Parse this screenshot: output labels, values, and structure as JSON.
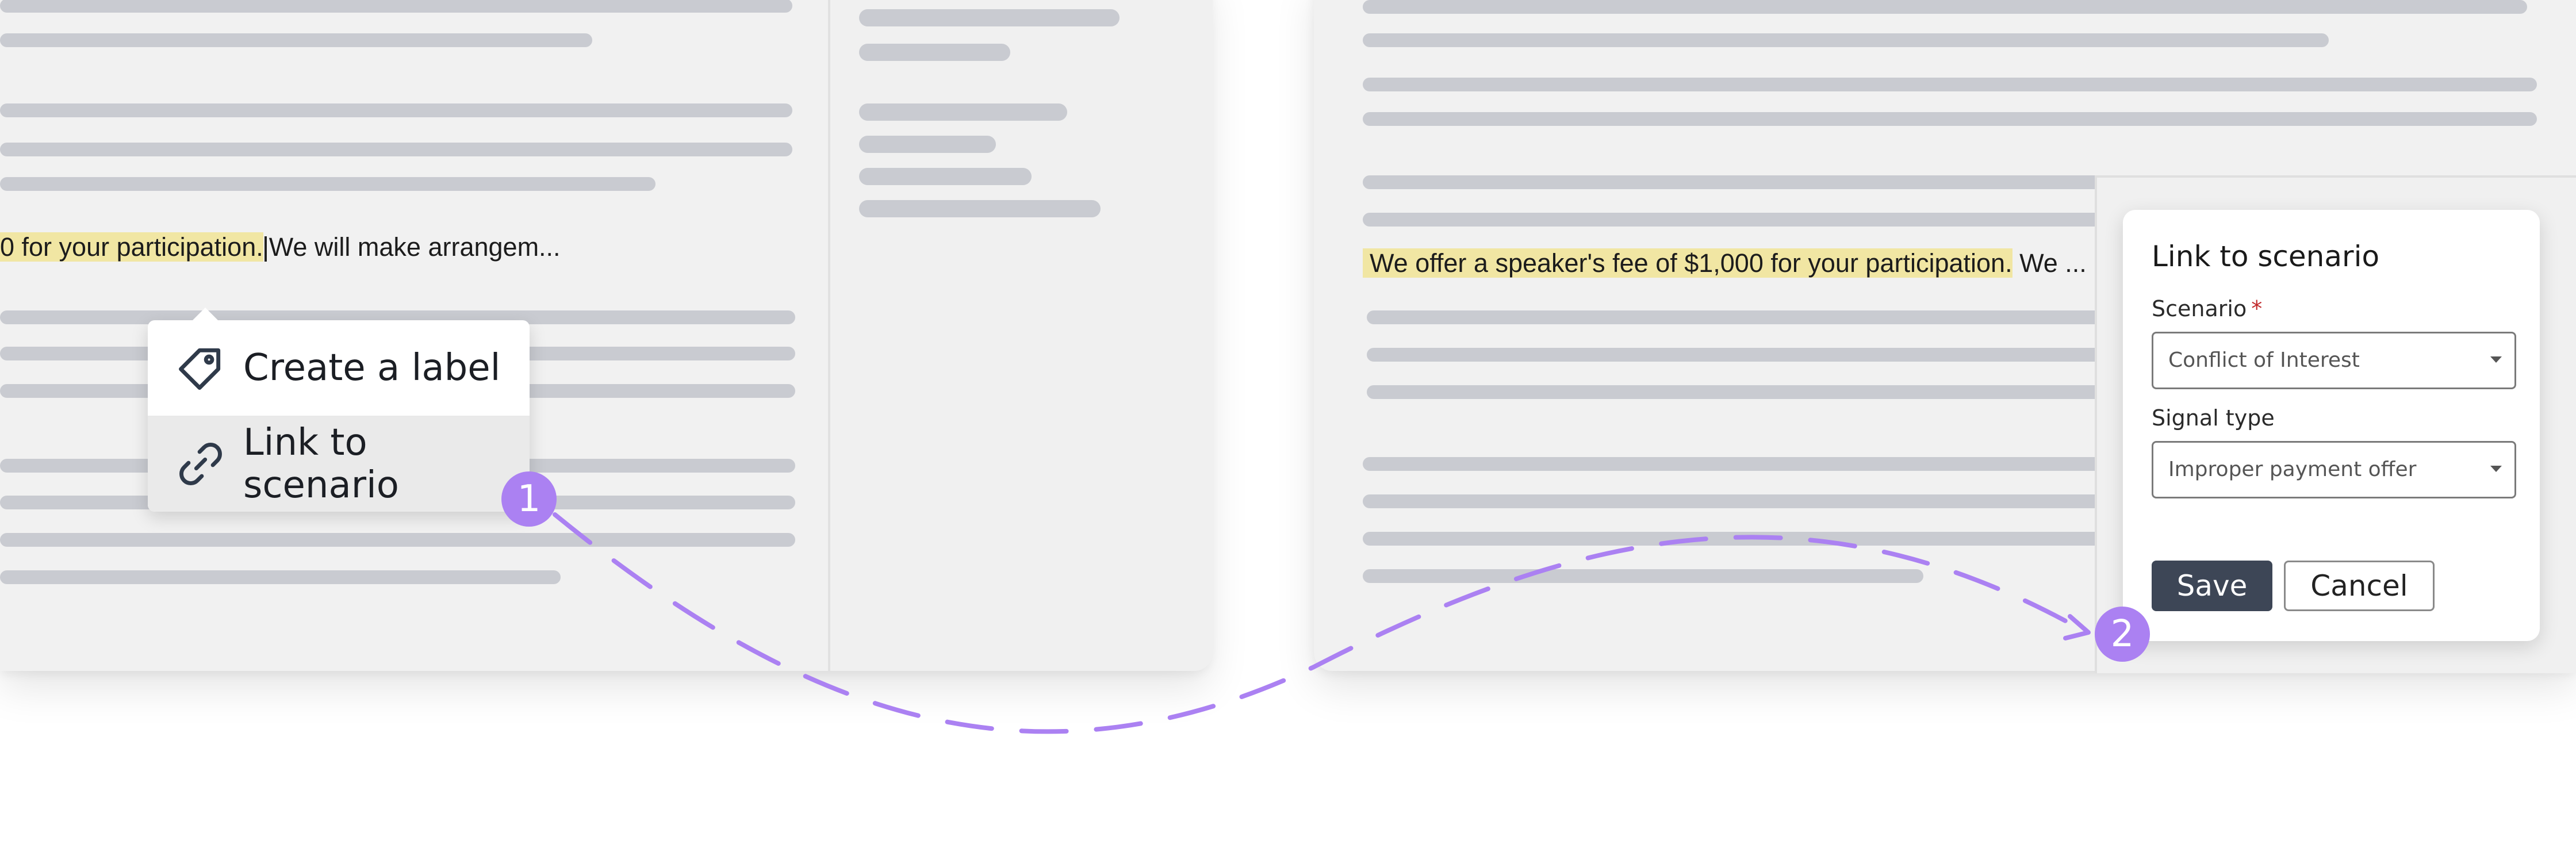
{
  "left_doc": {
    "highlighted_text": "0 for your participation.",
    "trailing_text": "We will make arrangem..."
  },
  "context_menu": {
    "items": [
      {
        "label": "Create a label",
        "icon": "tag-icon"
      },
      {
        "label": "Link to scenario",
        "icon": "link-icon"
      }
    ]
  },
  "steps": [
    "1",
    "2"
  ],
  "right_doc": {
    "highlighted_text": "We offer a speaker's fee of $1,000 for your participation.",
    "trailing_text": "We ..."
  },
  "dialog": {
    "title": "Link to scenario",
    "scenario_label": "Scenario",
    "required_mark": "*",
    "scenario_value": "Conflict of Interest",
    "signal_label": "Signal type",
    "signal_value": "Improper payment offer",
    "save_label": "Save",
    "cancel_label": "Cancel"
  },
  "colors": {
    "accent_purple": "#ab81f2",
    "highlight": "#f1e6a3",
    "primary_button": "#3d4656",
    "required": "#c0282a"
  }
}
